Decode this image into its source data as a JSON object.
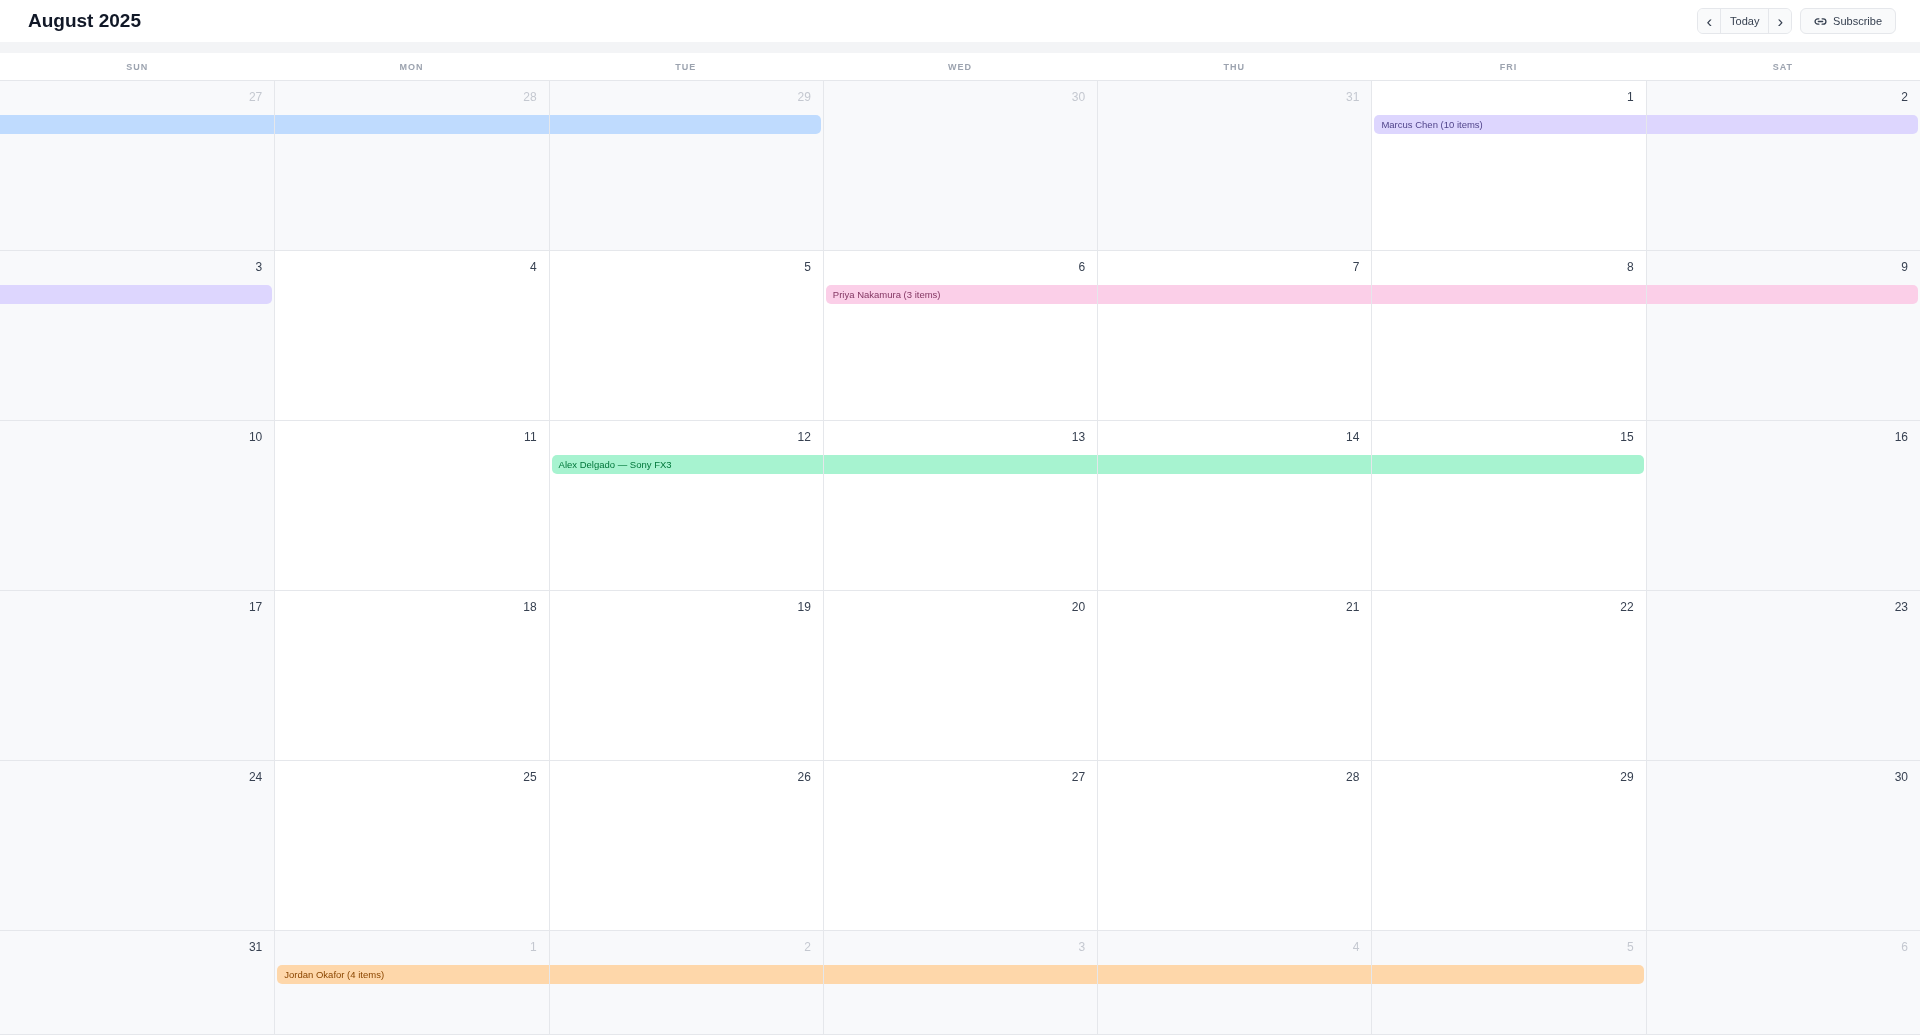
{
  "title": "August 2025",
  "nav": {
    "prev": "‹",
    "today": "Today",
    "next": "›",
    "subscribe": "Subscribe"
  },
  "weekdays": [
    "SUN",
    "MON",
    "TUE",
    "WED",
    "THU",
    "FRI",
    "SAT"
  ],
  "weeks": [
    {
      "days": [
        {
          "date": "27",
          "in_month": false,
          "event": {
            "color": "#bfdbfe",
            "starts": false,
            "ends": false
          }
        },
        {
          "date": "28",
          "in_month": false,
          "event": {
            "color": "#bfdbfe",
            "starts": false,
            "ends": false
          }
        },
        {
          "date": "29",
          "in_month": false,
          "event": {
            "color": "#bfdbfe",
            "starts": false,
            "ends": true
          }
        },
        {
          "date": "30",
          "in_month": false
        },
        {
          "date": "31",
          "in_month": false
        },
        {
          "date": "1",
          "in_month": true,
          "event": {
            "color": "#ddd6fe",
            "label": "Marcus Chen (10 items)",
            "starts": true,
            "ends": false
          }
        },
        {
          "date": "2",
          "in_month": true,
          "event": {
            "color": "#ddd6fe",
            "starts": false,
            "ends": true
          }
        }
      ]
    },
    {
      "days": [
        {
          "date": "3",
          "in_month": true,
          "event": {
            "color": "#ddd6fe",
            "starts": false,
            "ends": true
          }
        },
        {
          "date": "4",
          "in_month": true
        },
        {
          "date": "5",
          "in_month": true
        },
        {
          "date": "6",
          "in_month": true,
          "event": {
            "color": "#fbcfe8",
            "label": "Priya Nakamura (3 items)",
            "starts": true,
            "ends": false
          }
        },
        {
          "date": "7",
          "in_month": true,
          "event": {
            "color": "#fbcfe8",
            "starts": false,
            "ends": false
          }
        },
        {
          "date": "8",
          "in_month": true,
          "event": {
            "color": "#fbcfe8",
            "starts": false,
            "ends": false
          }
        },
        {
          "date": "9",
          "in_month": true,
          "event": {
            "color": "#fbcfe8",
            "starts": false,
            "ends": true
          }
        }
      ]
    },
    {
      "days": [
        {
          "date": "10",
          "in_month": true
        },
        {
          "date": "11",
          "in_month": true
        },
        {
          "date": "12",
          "in_month": true,
          "event": {
            "color": "#a7f3d0",
            "label": "Alex Delgado — Sony FX3",
            "starts": true,
            "ends": false
          }
        },
        {
          "date": "13",
          "in_month": true,
          "event": {
            "color": "#a7f3d0",
            "starts": false,
            "ends": false
          }
        },
        {
          "date": "14",
          "in_month": true,
          "event": {
            "color": "#a7f3d0",
            "starts": false,
            "ends": false
          }
        },
        {
          "date": "15",
          "in_month": true,
          "event": {
            "color": "#a7f3d0",
            "starts": false,
            "ends": true
          }
        },
        {
          "date": "16",
          "in_month": true
        }
      ]
    },
    {
      "days": [
        {
          "date": "17",
          "in_month": true
        },
        {
          "date": "18",
          "in_month": true
        },
        {
          "date": "19",
          "in_month": true
        },
        {
          "date": "20",
          "in_month": true
        },
        {
          "date": "21",
          "in_month": true
        },
        {
          "date": "22",
          "in_month": true
        },
        {
          "date": "23",
          "in_month": true
        }
      ]
    },
    {
      "days": [
        {
          "date": "24",
          "in_month": true
        },
        {
          "date": "25",
          "in_month": true
        },
        {
          "date": "26",
          "in_month": true
        },
        {
          "date": "27",
          "in_month": true
        },
        {
          "date": "28",
          "in_month": true
        },
        {
          "date": "29",
          "in_month": true
        },
        {
          "date": "30",
          "in_month": true
        }
      ]
    },
    {
      "days": [
        {
          "date": "31",
          "in_month": true
        },
        {
          "date": "1",
          "in_month": false,
          "event": {
            "color": "#fed7aa",
            "label": "Jordan Okafor (4 items)",
            "starts": true,
            "ends": false
          }
        },
        {
          "date": "2",
          "in_month": false,
          "event": {
            "color": "#fed7aa",
            "starts": false,
            "ends": false
          }
        },
        {
          "date": "3",
          "in_month": false,
          "event": {
            "color": "#fed7aa",
            "starts": false,
            "ends": false
          }
        },
        {
          "date": "4",
          "in_month": false,
          "event": {
            "color": "#fed7aa",
            "starts": false,
            "ends": false
          }
        },
        {
          "date": "5",
          "in_month": false,
          "event": {
            "color": "#fed7aa",
            "starts": false,
            "ends": true
          }
        },
        {
          "date": "6",
          "in_month": false
        }
      ]
    }
  ]
}
